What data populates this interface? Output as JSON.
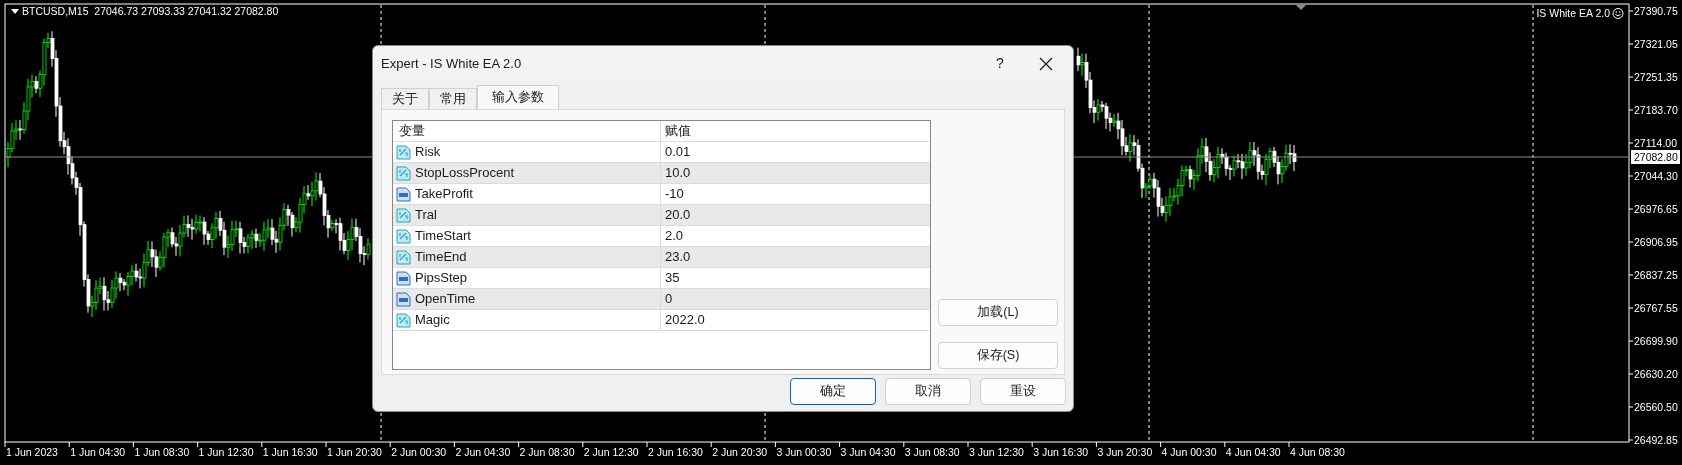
{
  "chart": {
    "symbol_info": "BTCUSD,M15  27046.73 27093.33 27041.32 27082.80",
    "expert_label": "IS White EA 2.0",
    "price_axis": [
      "27390.75",
      "27321.05",
      "27251.35",
      "27183.70",
      "27114.00",
      "27044.30",
      "26976.65",
      "26906.95",
      "26837.25",
      "26767.55",
      "26699.90",
      "26630.20",
      "26560.50",
      "26492.85"
    ],
    "current_price": "27082.80",
    "time_axis": [
      "1 Jun 2023",
      "1 Jun 04:30",
      "1 Jun 08:30",
      "1 Jun 12:30",
      "1 Jun 16:30",
      "1 Jun 20:30",
      "2 Jun 00:30",
      "2 Jun 04:30",
      "2 Jun 08:30",
      "2 Jun 12:30",
      "2 Jun 16:30",
      "2 Jun 20:30",
      "3 Jun 00:30",
      "3 Jun 04:30",
      "3 Jun 08:30",
      "3 Jun 12:30",
      "3 Jun 16:30",
      "3 Jun 20:30",
      "4 Jun 00:30",
      "4 Jun 04:30",
      "4 Jun 08:30"
    ]
  },
  "dialog": {
    "title": "Expert - IS White EA 2.0",
    "help": "?",
    "tabs": [
      {
        "label": "关于",
        "selected": false
      },
      {
        "label": "常用",
        "selected": false
      },
      {
        "label": "输入参数",
        "selected": true
      }
    ],
    "table": {
      "columns": [
        "变量",
        "赋值"
      ],
      "rows": [
        {
          "name": "Risk",
          "value": "0.01",
          "kind": "double"
        },
        {
          "name": "StopLossProcent",
          "value": "10.0",
          "kind": "double"
        },
        {
          "name": "TakeProfit",
          "value": "-10",
          "kind": "int"
        },
        {
          "name": "Tral",
          "value": "20.0",
          "kind": "double"
        },
        {
          "name": "TimeStart",
          "value": "2.0",
          "kind": "double"
        },
        {
          "name": "TimeEnd",
          "value": "23.0",
          "kind": "double"
        },
        {
          "name": "PipsStep",
          "value": "35",
          "kind": "int"
        },
        {
          "name": "OpenTime",
          "value": "0",
          "kind": "int"
        },
        {
          "name": "Magic",
          "value": "2022.0",
          "kind": "double"
        }
      ]
    },
    "side_buttons": [
      "加载(L)",
      "保存(S)"
    ],
    "buttons": [
      {
        "label": "确定",
        "default": true
      },
      {
        "label": "取消",
        "default": false
      },
      {
        "label": "重设",
        "default": false
      }
    ]
  }
}
